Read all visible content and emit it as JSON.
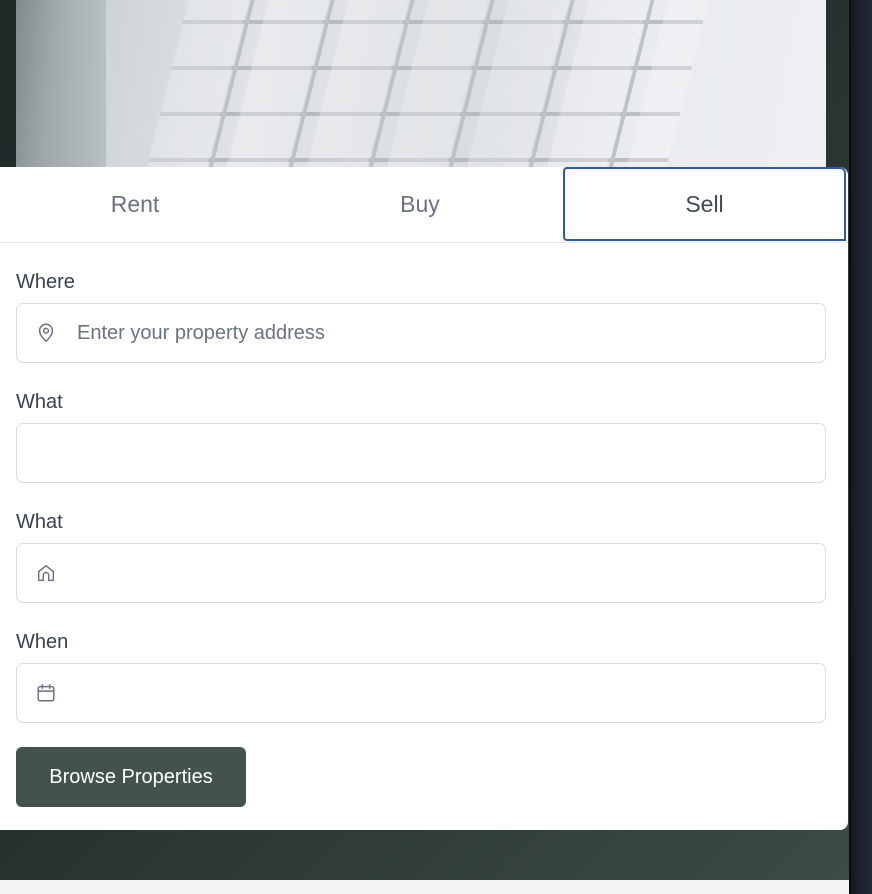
{
  "tabs": [
    {
      "label": "Rent",
      "active": false
    },
    {
      "label": "Buy",
      "active": false
    },
    {
      "label": "Sell",
      "active": true
    }
  ],
  "form": {
    "where": {
      "label": "Where",
      "placeholder": "Enter your property address",
      "icon": "location-pin-icon"
    },
    "what1": {
      "label": "What",
      "value": ""
    },
    "what2": {
      "label": "What",
      "value": "",
      "icon": "home-icon"
    },
    "when": {
      "label": "When",
      "value": "",
      "icon": "calendar-icon"
    }
  },
  "submit_label": "Browse Properties",
  "colors": {
    "button_bg": "#44524f",
    "active_tab_border": "#2d5ba8",
    "page_bg": "#25302d"
  }
}
